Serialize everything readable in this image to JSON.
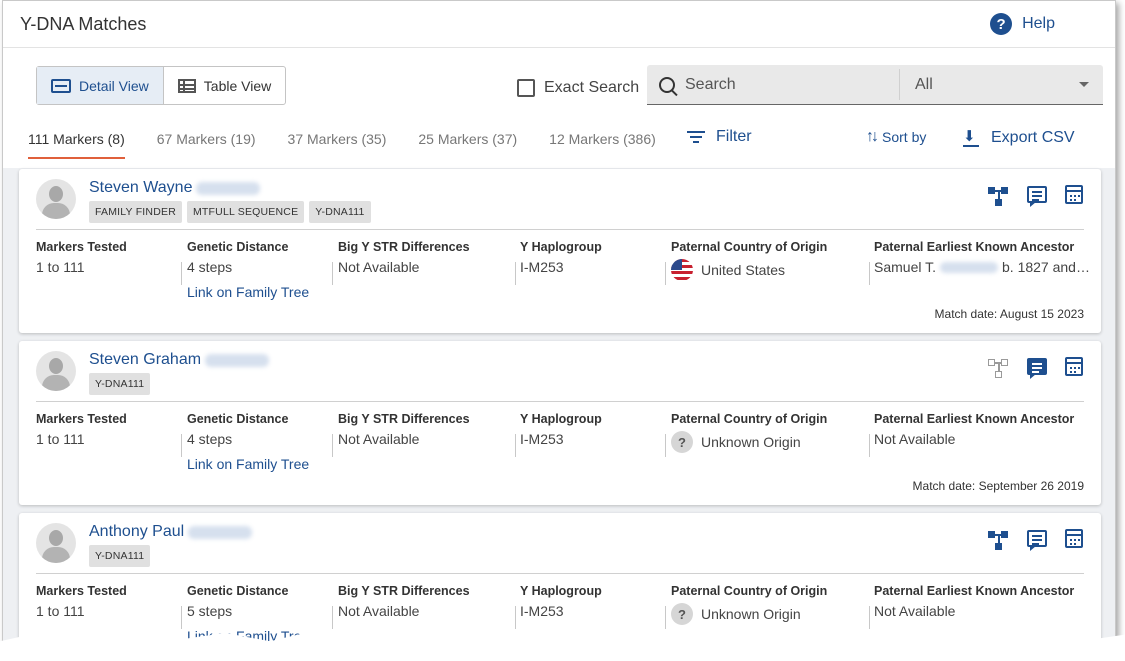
{
  "header": {
    "title": "Y-DNA Matches",
    "help_label": "Help"
  },
  "toolbar": {
    "detail_view_label": "Detail View",
    "table_view_label": "Table View",
    "exact_search_label": "Exact Search",
    "search_placeholder": "Search",
    "search_scope": "All",
    "filter_label": "Filter",
    "sort_label": "Sort by",
    "export_label": "Export CSV"
  },
  "tabs": [
    {
      "label": "111 Markers (8)",
      "active": true
    },
    {
      "label": "67 Markers (19)",
      "active": false
    },
    {
      "label": "37 Markers (35)",
      "active": false
    },
    {
      "label": "25 Markers (37)",
      "active": false
    },
    {
      "label": "12 Markers (386)",
      "active": false
    }
  ],
  "field_labels": {
    "markers": "Markers Tested",
    "distance": "Genetic Distance",
    "bigy": "Big Y STR Differences",
    "haplogroup": "Y Haplogroup",
    "country": "Paternal Country of Origin",
    "ancestor": "Paternal Earliest Known Ancestor"
  },
  "link_label": "Link on Family Tree",
  "matches": [
    {
      "name": "Steven Wayne",
      "badges": [
        "FAMILY FINDER",
        "MTFULL SEQUENCE",
        "Y-DNA111"
      ],
      "markers": "1 to 111",
      "distance": "4 steps",
      "bigy": "Not Available",
      "haplogroup": "I-M253",
      "country": "United States",
      "ancestor_prefix": "Samuel T.",
      "ancestor_suffix": "b. 1827 and…",
      "match_date": "Match date: August 15 2023"
    },
    {
      "name": "Steven Graham",
      "badges": [
        "Y-DNA111"
      ],
      "markers": "1 to 111",
      "distance": "4 steps",
      "bigy": "Not Available",
      "haplogroup": "I-M253",
      "country": "Unknown Origin",
      "ancestor": "Not Available",
      "match_date": "Match date: September 26 2019"
    },
    {
      "name": "Anthony Paul",
      "badges": [
        "Y-DNA111"
      ],
      "markers": "1 to 111",
      "distance": "5 steps",
      "bigy": "Not Available",
      "haplogroup": "I-M253",
      "country": "Unknown Origin",
      "ancestor": "Not Available"
    }
  ]
}
